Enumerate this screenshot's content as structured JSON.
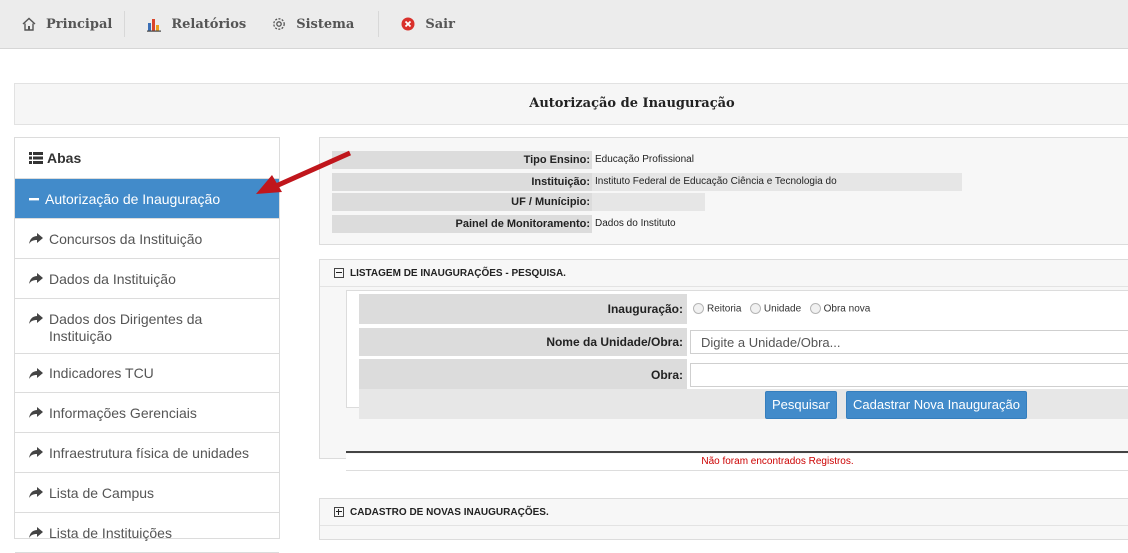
{
  "topnav": {
    "items": [
      {
        "label": "Principal",
        "icon": "home-icon"
      },
      {
        "label": "Relatórios",
        "icon": "chart-icon"
      },
      {
        "label": "Sistema",
        "icon": "gear-icon"
      },
      {
        "label": "Sair",
        "icon": "close-circle-icon"
      }
    ]
  },
  "page": {
    "title": "Autorização de Inauguração"
  },
  "sidebar": {
    "heading": "Abas",
    "items": [
      {
        "label": "Autorização de Inauguração",
        "active": true
      },
      {
        "label": "Concursos da Instituição"
      },
      {
        "label": "Dados da Instituição"
      },
      {
        "label": "Dados dos Dirigentes da Instituição"
      },
      {
        "label": "Indicadores TCU"
      },
      {
        "label": "Informações Gerenciais"
      },
      {
        "label": "Infraestrutura física de unidades"
      },
      {
        "label": "Lista de Campus"
      },
      {
        "label": "Lista de Instituições"
      }
    ]
  },
  "info": {
    "tipo_ensino_label": "Tipo Ensino:",
    "tipo_ensino_value": "Educação Profissional",
    "instituicao_label": "Instituição:",
    "instituicao_value": "Instituto Federal de Educação Ciência e Tecnologia do",
    "uf_label": "UF / Munícipio:",
    "uf_value": "",
    "painel_label": "Painel de Monitoramento:",
    "painel_value": "Dados do Instituto"
  },
  "listagem": {
    "title": "LISTAGEM DE INAUGURAÇÕES - PESQUISA.",
    "inauguracao_label": "Inauguração:",
    "radio_options": [
      "Reitoria",
      "Unidade",
      "Obra nova"
    ],
    "nome_label": "Nome da Unidade/Obra:",
    "nome_placeholder": "Digite a Unidade/Obra...",
    "obra_label": "Obra:",
    "obra_value": "",
    "pesquisar_label": "Pesquisar",
    "cadastrar_label": "Cadastrar Nova Inauguração",
    "no_records": "Não foram encontrados Registros."
  },
  "cadastro": {
    "title": "CADASTRO DE NOVAS INAUGURAÇÕES."
  },
  "colors": {
    "accent": "#428bca",
    "arrow": "#c0161c",
    "no_records": "#cc0000"
  }
}
